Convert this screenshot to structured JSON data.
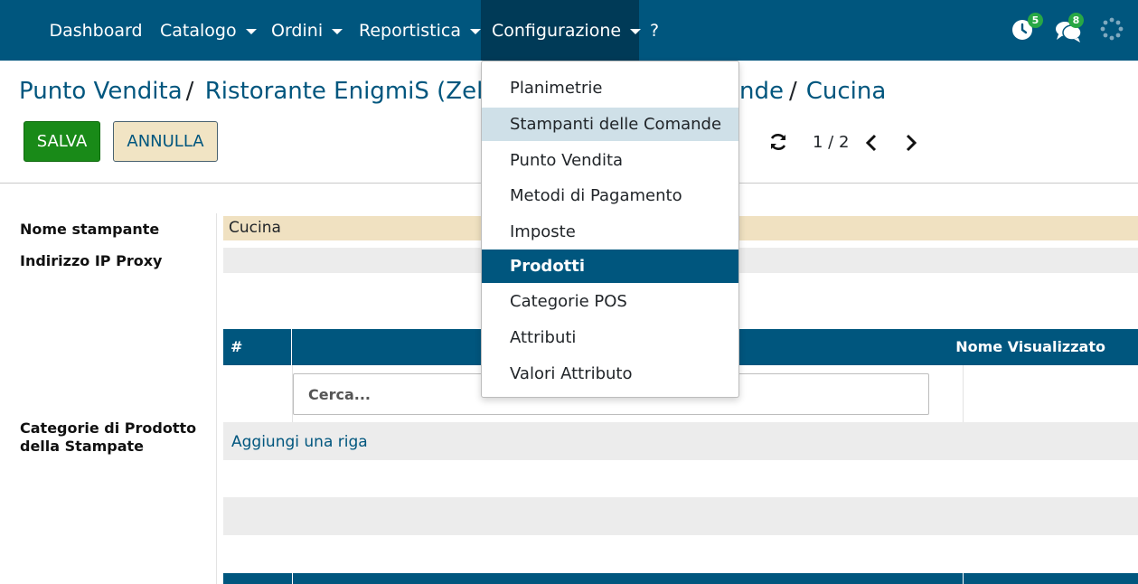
{
  "navbar": {
    "items": [
      {
        "label": "Dashboard",
        "has_caret": false
      },
      {
        "label": "Catalogo",
        "has_caret": true
      },
      {
        "label": "Ordini",
        "has_caret": true
      },
      {
        "label": "Reportistica",
        "has_caret": true
      },
      {
        "label": "Configurazione",
        "has_caret": true
      },
      {
        "label": "?",
        "has_caret": false
      }
    ],
    "activities_badge": "5",
    "messages_badge": "8",
    "color": "#00567e"
  },
  "breadcrumb": {
    "item1": "Punto Vendita",
    "item2": "Ristorante EnigmiS (Zelo)",
    "item3_partial": "nde",
    "current": "Cucina"
  },
  "buttons": {
    "save": "SALVA",
    "cancel": "ANNULLA"
  },
  "pager": {
    "value": "1 / 2"
  },
  "form": {
    "printer_name_label": "Nome stampante",
    "printer_name_value": "Cucina",
    "proxy_ip_label": "Indirizzo IP Proxy",
    "proxy_ip_value": "",
    "categories_label_line1": "Categorie di Prodotto",
    "categories_label_line2": "della Stampate"
  },
  "table": {
    "col_hash": "#",
    "col_display_name": "Nome Visualizzato",
    "search_placeholder": "Cerca...",
    "add_row": "Aggiungi una riga"
  },
  "dropdown": {
    "items": [
      {
        "label": "Planimetrie",
        "state": "normal"
      },
      {
        "label": "Stampanti delle Comande",
        "state": "hover"
      },
      {
        "label": "Punto Vendita",
        "state": "normal"
      },
      {
        "label": "Metodi di Pagamento",
        "state": "normal"
      },
      {
        "label": "Imposte",
        "state": "normal"
      },
      {
        "label": "Prodotti",
        "state": "active"
      },
      {
        "label": "Categorie POS",
        "state": "normal"
      },
      {
        "label": "Attributi",
        "state": "normal"
      },
      {
        "label": "Valori Attributo",
        "state": "normal"
      }
    ]
  }
}
